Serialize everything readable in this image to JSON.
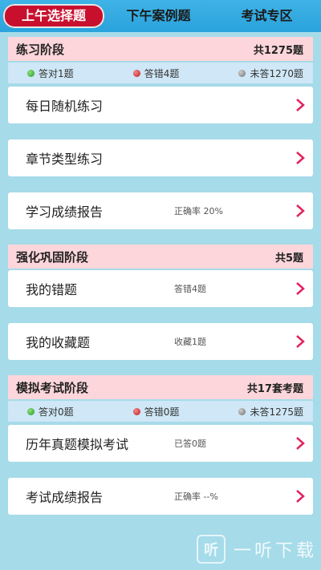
{
  "tabs": [
    {
      "label": "上午选择题",
      "active": true
    },
    {
      "label": "下午案例题",
      "active": false
    },
    {
      "label": "考试专区",
      "active": false
    }
  ],
  "sections": {
    "practice": {
      "title": "练习阶段",
      "count": "共1275题",
      "stats": {
        "correct": "答对1题",
        "wrong": "答错4题",
        "unanswered": "未答1270题"
      },
      "items": [
        {
          "label": "每日随机练习",
          "status": ""
        },
        {
          "label": "章节类型练习",
          "status": ""
        },
        {
          "label": "学习成绩报告",
          "status": "正确率 20%"
        }
      ]
    },
    "reinforce": {
      "title": "强化巩固阶段",
      "count": "共5题",
      "items": [
        {
          "label": "我的错题",
          "status": "答错4题"
        },
        {
          "label": "我的收藏题",
          "status": "收藏1题"
        }
      ]
    },
    "mock": {
      "title": "模拟考试阶段",
      "count": "共17套考题",
      "stats": {
        "correct": "答对0题",
        "wrong": "答错0题",
        "unanswered": "未答1275题"
      },
      "items": [
        {
          "label": "历年真题模拟考试",
          "status": "已答0题"
        },
        {
          "label": "考试成绩报告",
          "status": "正确率 --%"
        }
      ]
    }
  },
  "watermark": {
    "logo": "听",
    "text": "一听下载"
  },
  "colors": {
    "active_tab": "#c8102e",
    "section_head": "#fcd6db",
    "stats_bar": "#cfe7f6",
    "chevron": "#e0245e",
    "background": "#a6dbe9"
  }
}
